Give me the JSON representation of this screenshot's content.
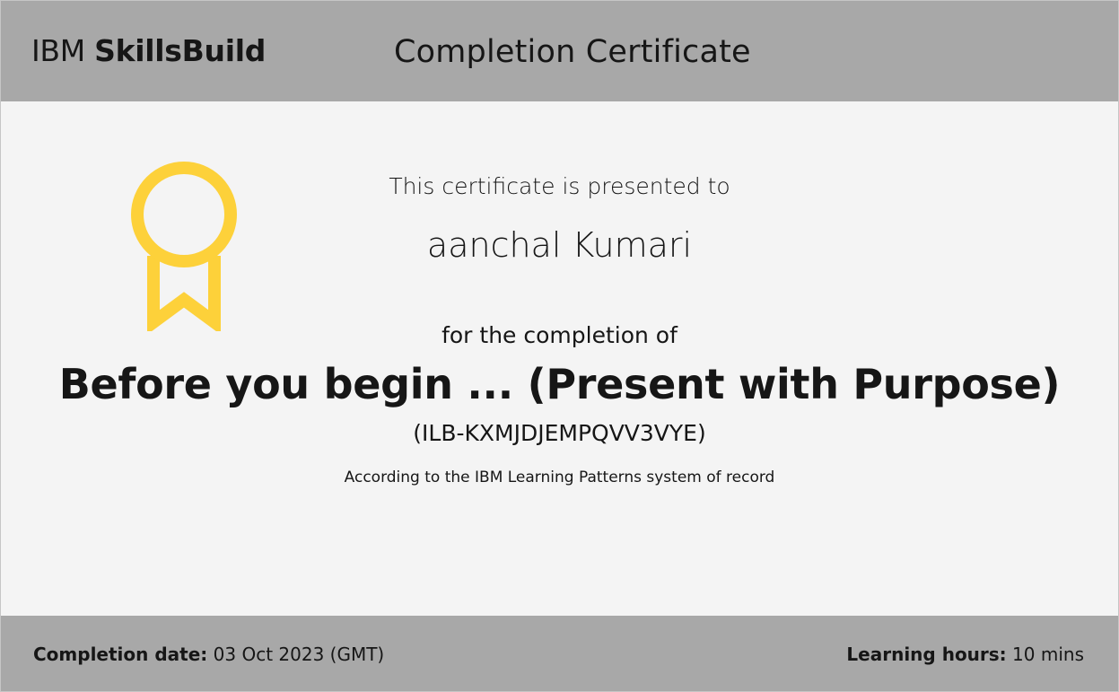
{
  "header": {
    "brand_prefix": "IBM",
    "brand_name": "SkillsBuild",
    "title": "Completion Certificate"
  },
  "certificate": {
    "presented_to_label": "This certificate is presented to",
    "recipient_name": "aanchal Kumari",
    "completion_label": "for the completion of",
    "course_title": "Before you begin ... (Present with Purpose)",
    "course_id": "(ILB-KXMJDJEMPQVV3VYE)",
    "record_note": "According to the IBM Learning Patterns system of record"
  },
  "footer": {
    "completion_date_label": "Completion date:",
    "completion_date_value": "03 Oct 2023 (GMT)",
    "learning_hours_label": "Learning hours:",
    "learning_hours_value": "10 mins"
  },
  "colors": {
    "band": "#a8a8a8",
    "background": "#f4f4f4",
    "badge": "#fdd13a",
    "text": "#161616"
  },
  "icons": {
    "badge": "award-ribbon-icon"
  }
}
